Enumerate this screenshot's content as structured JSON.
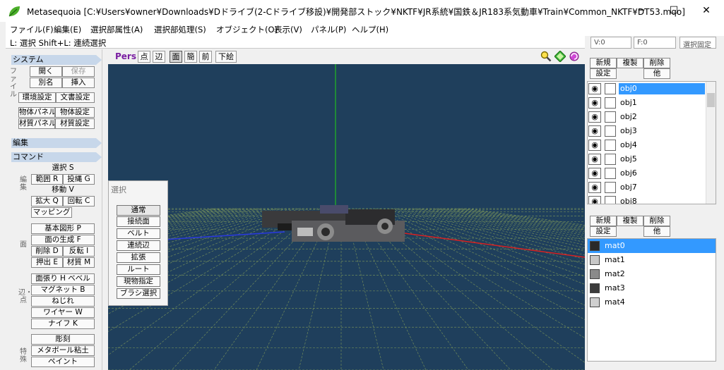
{
  "window": {
    "title": "Metasequoia [C:¥Users¥owner¥Downloads¥Dドライブ(2-Cドライブ移設)¥開発部ストック¥NKTF¥JR系統¥国鉄＆JR183系気動車¥Train¥Common_NKTF¥DT53.mqo]",
    "minimize": "─",
    "maximize": "☐",
    "close": "✕"
  },
  "menu": [
    "ファイル(F)",
    "編集(E)",
    "選択部属性(A)",
    "選択部処理(S)",
    "オブジェクト(O)",
    "表示(V)",
    "パネル(P)",
    "ヘルプ(H)"
  ],
  "hint": "L: 選択  Shift+L: 連続選択",
  "status": {
    "vertex": "V:0",
    "face": "F:0",
    "lock": "選択固定"
  },
  "left": {
    "system_header": "システム",
    "file_label": "ファイル",
    "open": "開く",
    "save": "保存",
    "saveas": "別名",
    "insert": "挿入",
    "env": "環境設定",
    "doc": "文書設定",
    "objpanel": "物体パネル",
    "objset": "物体設定",
    "matpanel": "材質パネル",
    "matset": "材質設定",
    "edit_header": "編集",
    "command_header": "コマンド",
    "select": "選択 S",
    "range": "範囲 R",
    "lasso": "投縄 G",
    "move": "移動 V",
    "scale": "拡大 Q",
    "rotate": "回転 C",
    "magic": "マッピング",
    "basic_label": "編集",
    "primitive": "基本図形 P",
    "gen_face": "面の生成 F",
    "delete": "削除 D",
    "invert": "反転 I",
    "extrude": "押出 E",
    "material": "材質 M",
    "face_label": "面",
    "stretch": "面張り H",
    "bevel": "ベベル",
    "magnet": "マグネット B",
    "twist": "ねじれ",
    "wire": "ワイヤー W",
    "knife": "ナイフ K",
    "edge_label": "辺・点",
    "sculpt": "彫刻",
    "metaball": "メタボール粘土",
    "paint": "ペイント",
    "special_label": "特殊"
  },
  "viewport": {
    "mode": "Pers",
    "buttons": [
      "点",
      "辺",
      "面",
      "簡",
      "前",
      "下絵"
    ],
    "active_button": "面",
    "grid_color": "#6f8a5a",
    "bg_color": "#1f3f5c"
  },
  "select_panel": {
    "title": "選択",
    "items": [
      "通常",
      "接続面",
      "ベルト",
      "連続辺",
      "拡張",
      "ルート",
      "現物指定",
      "ブラシ選択"
    ]
  },
  "objects": {
    "new": "新規",
    "copy": "複製",
    "delete": "削除",
    "settings": "設定",
    "other": "他",
    "items": [
      "obj0",
      "obj1",
      "obj2",
      "obj3",
      "obj4",
      "obj5",
      "obj6",
      "obj7",
      "obj8"
    ],
    "selected": "obj0"
  },
  "materials": {
    "new": "新規",
    "copy": "複製",
    "delete": "削除",
    "settings": "設定",
    "other": "他",
    "items": [
      {
        "name": "mat0",
        "color": "#2a2a2a"
      },
      {
        "name": "mat1",
        "color": "#c8c8c8"
      },
      {
        "name": "mat2",
        "color": "#8a8a8a"
      },
      {
        "name": "mat3",
        "color": "#3c3c3c"
      },
      {
        "name": "mat4",
        "color": "#cfcfcf"
      }
    ],
    "selected": "mat0"
  }
}
